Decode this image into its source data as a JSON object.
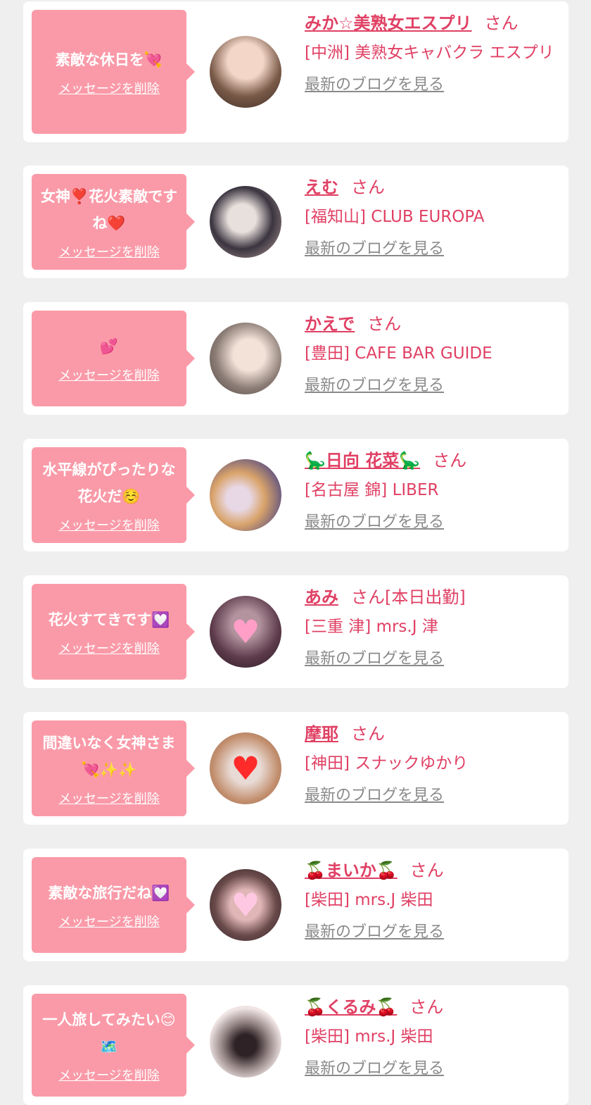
{
  "common": {
    "delete_label": "メッセージを削除",
    "blog_label": "最新のブログを見る",
    "san_label": "さん"
  },
  "items": [
    {
      "message": "素敵な休日を💘",
      "name": "みか☆美熟女エスプリ",
      "status": "",
      "shop": "[中洲] 美熟女キャバクラ エスプリ",
      "avatar_colors": [
        "#e0c2b0",
        "#7a5a48"
      ]
    },
    {
      "message": "女神❣️花火素敵ですね❤️",
      "name": "えむ",
      "status": "",
      "shop": "[福知山] CLUB EUROPA",
      "avatar_colors": [
        "#c9b7b7",
        "#2c2c35"
      ]
    },
    {
      "message": "💕",
      "name": "かえで",
      "status": "",
      "shop": "[豊田] CAFE BAR GUIDE",
      "avatar_colors": [
        "#eadbd2",
        "#5b4c48"
      ]
    },
    {
      "message": "水平線がぴったりな花火だ☺️",
      "name": "🦕日向 花菜🦕",
      "status": "",
      "shop": "[名古屋 錦] LIBER",
      "avatar_colors": [
        "#d9a36a",
        "#6e5c7e"
      ]
    },
    {
      "message": "花火すてきです💟",
      "name": "あみ",
      "status": "[本日出勤]",
      "shop": "[三重 津] mrs.J 津",
      "avatar_colors": [
        "#5d3b4b",
        "#b3939e"
      ]
    },
    {
      "message": "間違いなく女神さま💘✨✨",
      "name": "摩耶",
      "status": "",
      "shop": "[神田] スナックゆかり",
      "avatar_colors": [
        "#e8dad4",
        "#c28e6d"
      ]
    },
    {
      "message": "素敵な旅行だね💟",
      "name": "🍒まいか🍒",
      "status": "",
      "shop": "[柴田] mrs.J 柴田",
      "avatar_colors": [
        "#2a1f24",
        "#e0b6b7"
      ]
    },
    {
      "message": "一人旅してみたい😊🗺️",
      "name": "🍒くるみ🍒",
      "status": "",
      "shop": "[柴田] mrs.J 柴田",
      "avatar_colors": [
        "#f1e6e6",
        "#2e2226"
      ]
    }
  ]
}
